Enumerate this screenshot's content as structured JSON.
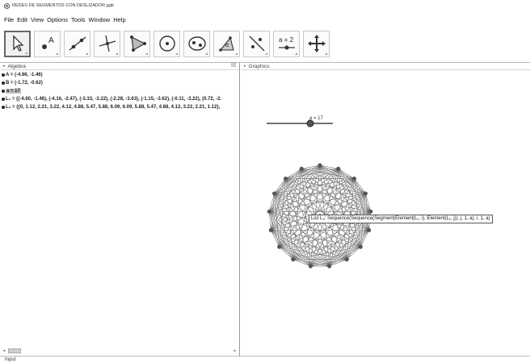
{
  "window": {
    "title": "REDES DE SEGMENTOS CON DESLIZADOR.ggb"
  },
  "menu": [
    "File",
    "Edit",
    "View",
    "Options",
    "Tools",
    "Window",
    "Help"
  ],
  "toolbar": {
    "tools": [
      {
        "name": "move-tool-icon",
        "active": true
      },
      {
        "name": "point-tool-icon",
        "label": "A"
      },
      {
        "name": "line-tool-icon"
      },
      {
        "name": "perpendicular-line-tool-icon"
      },
      {
        "name": "polygon-tool-icon"
      },
      {
        "name": "circle-tool-icon"
      },
      {
        "name": "ellipse-tool-icon"
      },
      {
        "name": "angle-tool-icon",
        "label": "α"
      },
      {
        "name": "reflect-tool-icon"
      },
      {
        "name": "slider-tool-icon",
        "label": "a = 2"
      },
      {
        "name": "move-graphics-view-tool-icon"
      }
    ]
  },
  "algebra": {
    "title": "Algebra",
    "close_symbol": "☒",
    "rows": [
      {
        "text": "A = (-4.66, -1.46)"
      },
      {
        "text": "B = (-1.72, -0.62)"
      },
      {
        "text": "a = 17",
        "selected": true
      },
      {
        "text": "L₁ = {(-4.60, -1.46), (-4.16, -2.47), (-3.33, -3.22), (-2.28, -3.63), (-1.15, -3.62), (-0.11, -3.22), (0.72, -2."
      },
      {
        "text": "L₂ = {{0, 1.12, 2.21, 3.22, 4.12, 4.88, 5.47, 5.88, 6.09, 6.09, 5.88, 5.47, 4.88, 4.12, 3.22, 2.21, 1.12},"
      }
    ]
  },
  "graphics": {
    "title": "Graphics",
    "slider_label": "a = 17",
    "slider_value": 17,
    "points_count": 17,
    "tooltip": "List L₃: Sequence(Sequence(Segment(Element(L₁, i), Element(L₁, j)), j, 1, a), i, 1, a)"
  },
  "input_bar": {
    "label": "Input"
  },
  "colors": {
    "accent": "#555555",
    "panel_border": "#9a9a9a",
    "selection": "#bdbdbd"
  }
}
